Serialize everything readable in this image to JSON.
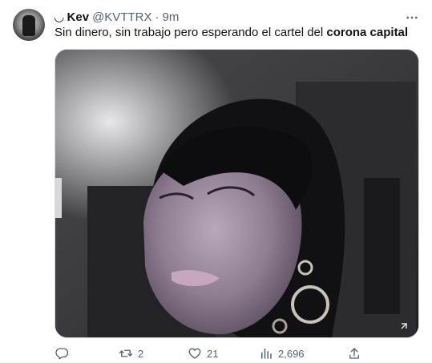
{
  "tweet": {
    "author_glyph": "◡",
    "author_name": "Kev",
    "handle": "@KVTTRX",
    "separator": "·",
    "time": "9m",
    "text_plain": "Sin dinero, sin trabajo pero esperando el cartel del ",
    "text_bold": "corona capital"
  },
  "actions": {
    "reply_count": "",
    "retweet_count": "2",
    "like_count": "21",
    "views_count": "2,696"
  },
  "icons": {
    "more": "more-horizontal-icon",
    "reply": "reply-icon",
    "retweet": "retweet-icon",
    "like": "heart-icon",
    "views": "views-chart-icon",
    "share": "share-icon"
  },
  "colors": {
    "text_primary": "#0f1419",
    "text_secondary": "#536471"
  }
}
